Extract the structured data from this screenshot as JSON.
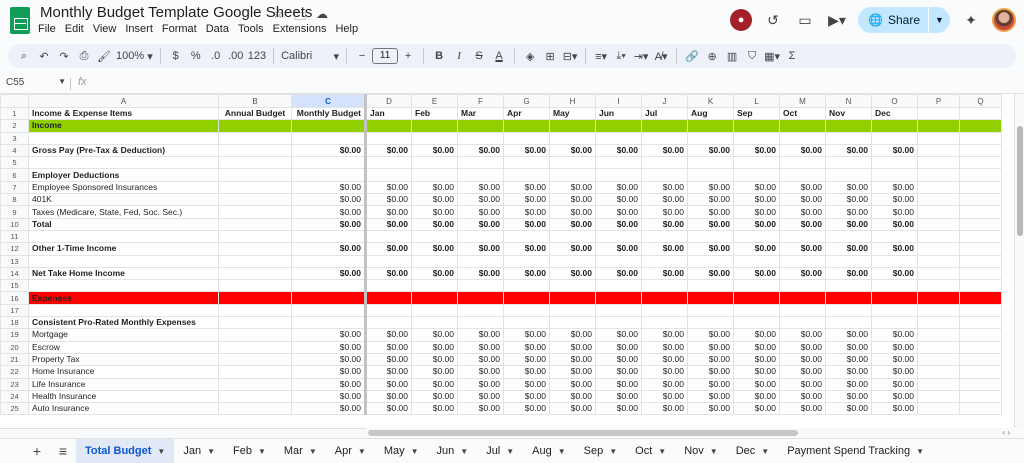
{
  "app": {
    "title": "Monthly Budget Template Google Sheets",
    "menu": [
      "File",
      "Edit",
      "View",
      "Insert",
      "Format",
      "Data",
      "Tools",
      "Extensions",
      "Help"
    ],
    "share_label": "Share"
  },
  "toolbar": {
    "zoom": "100%",
    "currency": "$",
    "percent": "%",
    "decrease_decimal": ".0",
    "increase_decimal": ".00",
    "number_format": "123",
    "font": "Calibri",
    "font_size": "11"
  },
  "formula_bar": {
    "name_box": "C55",
    "fx": "fx",
    "value": ""
  },
  "grid": {
    "columns": [
      "A",
      "B",
      "C",
      "D",
      "E",
      "F",
      "G",
      "H",
      "I",
      "J",
      "K",
      "L",
      "M",
      "N",
      "O",
      "P",
      "Q"
    ],
    "selected_column": "C",
    "rows": [
      {
        "n": "1",
        "style": "header",
        "cells": [
          "Income & Expense Items",
          "Annual Budget",
          "Monthly Budget",
          "Jan",
          "Feb",
          "Mar",
          "Apr",
          "May",
          "Jun",
          "Jul",
          "Aug",
          "Sep",
          "Oct",
          "Nov",
          "Dec",
          "",
          ""
        ]
      },
      {
        "n": "2",
        "style": "green",
        "cells": [
          "Income",
          "",
          "",
          "",
          "",
          "",
          "",
          "",
          "",
          "",
          "",
          "",
          "",
          "",
          "",
          "",
          ""
        ]
      },
      {
        "n": "3",
        "style": "",
        "cells": [
          "",
          "",
          "",
          "",
          "",
          "",
          "",
          "",
          "",
          "",
          "",
          "",
          "",
          "",
          "",
          "",
          ""
        ]
      },
      {
        "n": "4",
        "style": "bold",
        "cells": [
          "Gross Pay (Pre-Tax & Deduction)",
          "",
          "$0.00",
          "$0.00",
          "$0.00",
          "$0.00",
          "$0.00",
          "$0.00",
          "$0.00",
          "$0.00",
          "$0.00",
          "$0.00",
          "$0.00",
          "$0.00",
          "$0.00",
          "",
          ""
        ]
      },
      {
        "n": "5",
        "style": "",
        "cells": [
          "",
          "",
          "",
          "",
          "",
          "",
          "",
          "",
          "",
          "",
          "",
          "",
          "",
          "",
          "",
          "",
          ""
        ]
      },
      {
        "n": "6",
        "style": "bold",
        "cells": [
          "Employer Deductions",
          "",
          "",
          "",
          "",
          "",
          "",
          "",
          "",
          "",
          "",
          "",
          "",
          "",
          "",
          "",
          ""
        ]
      },
      {
        "n": "7",
        "style": "",
        "cells": [
          "Employee Sponsored Insurances",
          "",
          "$0.00",
          "$0.00",
          "$0.00",
          "$0.00",
          "$0.00",
          "$0.00",
          "$0.00",
          "$0.00",
          "$0.00",
          "$0.00",
          "$0.00",
          "$0.00",
          "$0.00",
          "",
          ""
        ]
      },
      {
        "n": "8",
        "style": "",
        "cells": [
          "401K",
          "",
          "$0.00",
          "$0.00",
          "$0.00",
          "$0.00",
          "$0.00",
          "$0.00",
          "$0.00",
          "$0.00",
          "$0.00",
          "$0.00",
          "$0.00",
          "$0.00",
          "$0.00",
          "",
          ""
        ]
      },
      {
        "n": "9",
        "style": "",
        "cells": [
          "Taxes (Medicare, State, Fed, Soc. Sec.)",
          "",
          "$0.00",
          "$0.00",
          "$0.00",
          "$0.00",
          "$0.00",
          "$0.00",
          "$0.00",
          "$0.00",
          "$0.00",
          "$0.00",
          "$0.00",
          "$0.00",
          "$0.00",
          "",
          ""
        ]
      },
      {
        "n": "10",
        "style": "bold",
        "cells": [
          "Total",
          "",
          "$0.00",
          "$0.00",
          "$0.00",
          "$0.00",
          "$0.00",
          "$0.00",
          "$0.00",
          "$0.00",
          "$0.00",
          "$0.00",
          "$0.00",
          "$0.00",
          "$0.00",
          "",
          ""
        ]
      },
      {
        "n": "11",
        "style": "",
        "cells": [
          "",
          "",
          "",
          "",
          "",
          "",
          "",
          "",
          "",
          "",
          "",
          "",
          "",
          "",
          "",
          "",
          ""
        ]
      },
      {
        "n": "12",
        "style": "bold",
        "cells": [
          "Other 1-Time Income",
          "",
          "$0.00",
          "$0.00",
          "$0.00",
          "$0.00",
          "$0.00",
          "$0.00",
          "$0.00",
          "$0.00",
          "$0.00",
          "$0.00",
          "$0.00",
          "$0.00",
          "$0.00",
          "",
          ""
        ]
      },
      {
        "n": "13",
        "style": "",
        "cells": [
          "",
          "",
          "",
          "",
          "",
          "",
          "",
          "",
          "",
          "",
          "",
          "",
          "",
          "",
          "",
          "",
          ""
        ]
      },
      {
        "n": "14",
        "style": "bold",
        "cells": [
          "Net Take Home Income",
          "",
          "$0.00",
          "$0.00",
          "$0.00",
          "$0.00",
          "$0.00",
          "$0.00",
          "$0.00",
          "$0.00",
          "$0.00",
          "$0.00",
          "$0.00",
          "$0.00",
          "$0.00",
          "",
          ""
        ]
      },
      {
        "n": "15",
        "style": "",
        "cells": [
          "",
          "",
          "",
          "",
          "",
          "",
          "",
          "",
          "",
          "",
          "",
          "",
          "",
          "",
          "",
          "",
          ""
        ]
      },
      {
        "n": "16",
        "style": "red",
        "cells": [
          "Expenses",
          "",
          "",
          "",
          "",
          "",
          "",
          "",
          "",
          "",
          "",
          "",
          "",
          "",
          "",
          "",
          ""
        ]
      },
      {
        "n": "17",
        "style": "",
        "cells": [
          "",
          "",
          "",
          "",
          "",
          "",
          "",
          "",
          "",
          "",
          "",
          "",
          "",
          "",
          "",
          "",
          ""
        ]
      },
      {
        "n": "18",
        "style": "bold",
        "cells": [
          "Consistent Pro-Rated Monthly Expenses",
          "",
          "",
          "",
          "",
          "",
          "",
          "",
          "",
          "",
          "",
          "",
          "",
          "",
          "",
          "",
          ""
        ]
      },
      {
        "n": "19",
        "style": "",
        "cells": [
          "Mortgage",
          "",
          "$0.00",
          "$0.00",
          "$0.00",
          "$0.00",
          "$0.00",
          "$0.00",
          "$0.00",
          "$0.00",
          "$0.00",
          "$0.00",
          "$0.00",
          "$0.00",
          "$0.00",
          "",
          ""
        ]
      },
      {
        "n": "20",
        "style": "",
        "cells": [
          "Escrow",
          "",
          "$0.00",
          "$0.00",
          "$0.00",
          "$0.00",
          "$0.00",
          "$0.00",
          "$0.00",
          "$0.00",
          "$0.00",
          "$0.00",
          "$0.00",
          "$0.00",
          "$0.00",
          "",
          ""
        ]
      },
      {
        "n": "21",
        "style": "",
        "cells": [
          "Property Tax",
          "",
          "$0.00",
          "$0.00",
          "$0.00",
          "$0.00",
          "$0.00",
          "$0.00",
          "$0.00",
          "$0.00",
          "$0.00",
          "$0.00",
          "$0.00",
          "$0.00",
          "$0.00",
          "",
          ""
        ]
      },
      {
        "n": "22",
        "style": "",
        "cells": [
          "Home Insurance",
          "",
          "$0.00",
          "$0.00",
          "$0.00",
          "$0.00",
          "$0.00",
          "$0.00",
          "$0.00",
          "$0.00",
          "$0.00",
          "$0.00",
          "$0.00",
          "$0.00",
          "$0.00",
          "",
          ""
        ]
      },
      {
        "n": "23",
        "style": "",
        "cells": [
          "Life Insurance",
          "",
          "$0.00",
          "$0.00",
          "$0.00",
          "$0.00",
          "$0.00",
          "$0.00",
          "$0.00",
          "$0.00",
          "$0.00",
          "$0.00",
          "$0.00",
          "$0.00",
          "$0.00",
          "",
          ""
        ]
      },
      {
        "n": "24",
        "style": "",
        "cells": [
          "Health Insurance",
          "",
          "$0.00",
          "$0.00",
          "$0.00",
          "$0.00",
          "$0.00",
          "$0.00",
          "$0.00",
          "$0.00",
          "$0.00",
          "$0.00",
          "$0.00",
          "$0.00",
          "$0.00",
          "",
          ""
        ]
      },
      {
        "n": "25",
        "style": "",
        "cells": [
          "Auto Insurance",
          "",
          "$0.00",
          "$0.00",
          "$0.00",
          "$0.00",
          "$0.00",
          "$0.00",
          "$0.00",
          "$0.00",
          "$0.00",
          "$0.00",
          "$0.00",
          "$0.00",
          "$0.00",
          "",
          ""
        ]
      }
    ]
  },
  "sheets": {
    "active": "Total Budget",
    "tabs": [
      "Total Budget",
      "Jan",
      "Feb",
      "Mar",
      "Apr",
      "May",
      "Jun",
      "Jul",
      "Aug",
      "Sep",
      "Oct",
      "Nov",
      "Dec",
      "Payment Spend Tracking"
    ]
  },
  "colors": {
    "income_band": "#92d000",
    "expenses_band": "#ff0000",
    "share_button": "#c2e7ff",
    "active_tab_text": "#0b57d0"
  },
  "icons": {
    "title": [
      "star-icon",
      "move-to-folder-icon",
      "cloud-saved-icon"
    ],
    "top_right": [
      "recording-icon",
      "history-icon",
      "comment-icon",
      "meet-camera-icon",
      "gemini-sparkle-icon"
    ],
    "toolbar": [
      "search-icon",
      "undo-icon",
      "redo-icon",
      "print-icon",
      "paint-format-icon",
      "bold-icon",
      "italic-icon",
      "strikethrough-icon",
      "text-color-icon",
      "fill-color-icon",
      "borders-icon",
      "merge-cells-icon",
      "align-icon",
      "valign-icon",
      "wrap-icon",
      "rotate-icon",
      "link-icon",
      "comment-icon",
      "chart-icon",
      "filter-icon",
      "filter-views-icon",
      "functions-icon"
    ]
  }
}
